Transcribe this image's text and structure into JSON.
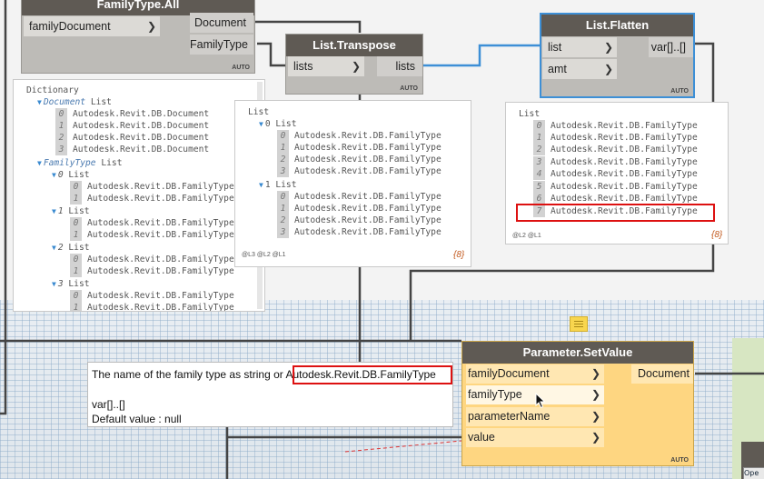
{
  "nodes": {
    "familytype_all": {
      "title": "FamilyType.All",
      "input": "familyDocument",
      "outputs": [
        "Document",
        "FamilyType"
      ],
      "auto": "AUTO"
    },
    "list_transpose": {
      "title": "List.Transpose",
      "input": "lists",
      "output": "lists",
      "auto": "AUTO"
    },
    "list_flatten": {
      "title": "List.Flatten",
      "inputs": [
        "list",
        "amt"
      ],
      "output": "var[]..[]",
      "auto": "AUTO"
    },
    "set_value": {
      "title": "Parameter.SetValue",
      "inputs": [
        "familyDocument",
        "familyType",
        "parameterName",
        "value"
      ],
      "output": "Document",
      "auto": "AUTO"
    }
  },
  "preview_dictionary": {
    "header": "Dictionary",
    "doc_key": "Document",
    "doc_list": "List",
    "doc_items": [
      "Autodesk.Revit.DB.Document",
      "Autodesk.Revit.DB.Document",
      "Autodesk.Revit.DB.Document",
      "Autodesk.Revit.DB.Document"
    ],
    "ft_key": "FamilyType",
    "ft_list": "List",
    "sub_list_label": "List",
    "sub_lists": [
      {
        "index": "0",
        "items": [
          "Autodesk.Revit.DB.FamilyType",
          "Autodesk.Revit.DB.FamilyType"
        ]
      },
      {
        "index": "1",
        "items": [
          "Autodesk.Revit.DB.FamilyType",
          "Autodesk.Revit.DB.FamilyType"
        ]
      },
      {
        "index": "2",
        "items": [
          "Autodesk.Revit.DB.FamilyType",
          "Autodesk.Revit.DB.FamilyType"
        ]
      },
      {
        "index": "3",
        "items": [
          "Autodesk.Revit.DB.FamilyType",
          "Autodesk.Revit.DB.FamilyType"
        ]
      }
    ]
  },
  "preview_transpose": {
    "header": "List",
    "groups": [
      {
        "label": "0 List",
        "items": [
          "Autodesk.Revit.DB.FamilyType",
          "Autodesk.Revit.DB.FamilyType",
          "Autodesk.Revit.DB.FamilyType",
          "Autodesk.Revit.DB.FamilyType"
        ]
      },
      {
        "label": "1 List",
        "items": [
          "Autodesk.Revit.DB.FamilyType",
          "Autodesk.Revit.DB.FamilyType",
          "Autodesk.Revit.DB.FamilyType",
          "Autodesk.Revit.DB.FamilyType"
        ]
      }
    ],
    "levels": "@L3 @L2 @L1",
    "count": "{8}"
  },
  "preview_flatten": {
    "header": "List",
    "items": [
      "Autodesk.Revit.DB.FamilyType",
      "Autodesk.Revit.DB.FamilyType",
      "Autodesk.Revit.DB.FamilyType",
      "Autodesk.Revit.DB.FamilyType",
      "Autodesk.Revit.DB.FamilyType",
      "Autodesk.Revit.DB.FamilyType",
      "Autodesk.Revit.DB.FamilyType",
      "Autodesk.Revit.DB.FamilyType"
    ],
    "levels": "@L2 @L1",
    "count": "{8}"
  },
  "tooltip": {
    "line1_prefix": "The name of the family type as string or ",
    "line1_highlight": "Autodesk.Revit.DB.FamilyType",
    "line2": "var[]..[]",
    "line3": "Default value : null"
  },
  "colors": {
    "node_header": "#5f5a54",
    "node_body": "#bdbbb7",
    "selected_border": "#3d8fd6",
    "setvalue_body": "#fed681",
    "highlight_red": "#dd1111",
    "wire": "#444444",
    "wire_selected": "#3d8fd6",
    "count_text": "#c2581c"
  },
  "icons": [
    "chevron-right-icon",
    "expand-triangle-icon",
    "note-icon",
    "mouse-cursor-icon"
  ],
  "bottom_widget": {
    "label": "Ope"
  }
}
